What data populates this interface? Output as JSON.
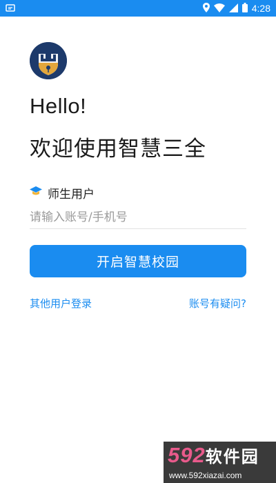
{
  "status_bar": {
    "time": "4:28",
    "icons": [
      "notification-icon",
      "location-icon",
      "wifi-icon",
      "signal-icon",
      "battery-icon"
    ],
    "color": "#1a8cf0"
  },
  "header": {
    "logo": "school-crest-logo",
    "greeting": "Hello!",
    "welcome": "欢迎使用智慧三全"
  },
  "login": {
    "role_label": "师生用户",
    "role_icon": "graduation-cap-icon",
    "account_placeholder": "请输入账号/手机号",
    "account_value": "",
    "submit_label": "开启智慧校园",
    "accent": "#1a8cf0"
  },
  "links": {
    "other_login": "其他用户登录",
    "account_help": "账号有疑问?"
  },
  "watermark": {
    "brand_number": "592",
    "brand_text": "软件园",
    "url": "www.592xiazai.com"
  }
}
